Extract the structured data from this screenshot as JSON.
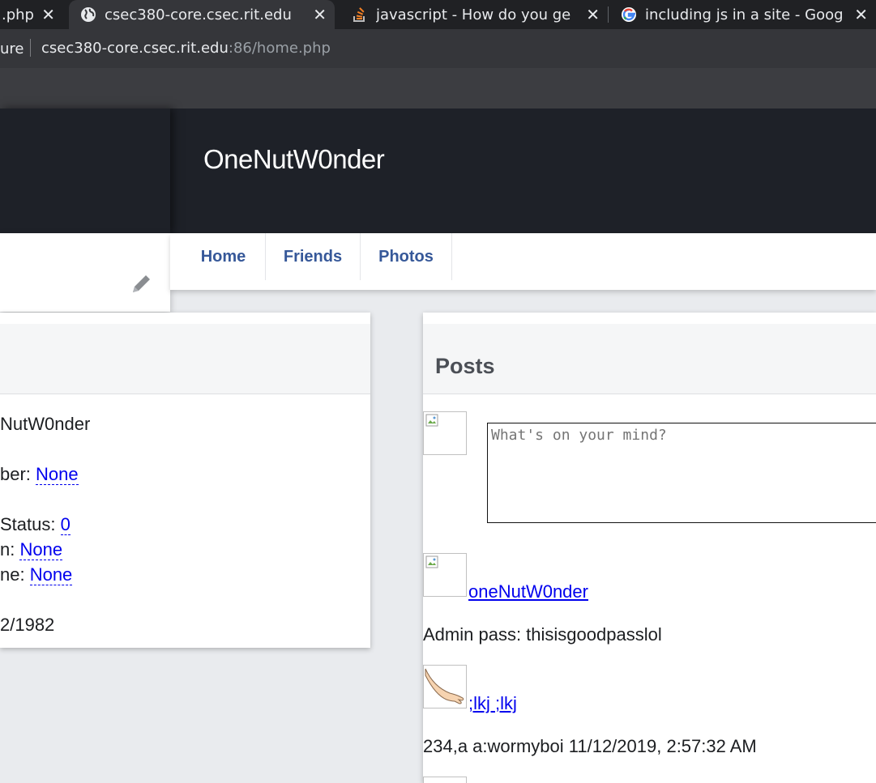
{
  "browser": {
    "tabs": [
      {
        "title": ".php",
        "icon": "none"
      },
      {
        "title": "csec380-core.csec.rit.edu",
        "icon": "globe-icon",
        "active": true
      },
      {
        "title": "javascript - How do you ge",
        "icon": "stackoverflow-icon"
      },
      {
        "title": "including js in a site - Goog",
        "icon": "google-icon"
      }
    ],
    "close_glyph": "✕",
    "security_label": "ure",
    "url_host": "csec380-core.csec.rit.edu",
    "url_rest": ":86/home.php"
  },
  "profile": {
    "name": "OneNutW0nder"
  },
  "nav": {
    "items": [
      "Home",
      "Friends",
      "Photos"
    ]
  },
  "about": {
    "name_fragment": "NutW0nder",
    "number_label": "ber: ",
    "number_value": "None",
    "status_label": "Status: ",
    "status_value": "0",
    "row2_label": "n: ",
    "row2_value": "None",
    "row3_label": "ne: ",
    "row3_value": "None",
    "date_fragment": "2/1982"
  },
  "posts": {
    "title": "Posts",
    "composer_placeholder": "What's on your mind?",
    "items": [
      {
        "author": "oneNutW0nder",
        "text": "Admin pass: thisisgoodpasslol"
      },
      {
        "author": ";lkj ;lkj",
        "text": "234,a a:wormyboi 11/12/2019, 2:57:32 AM"
      }
    ]
  },
  "colors": {
    "banner": "#1e2128",
    "nav_link": "#365899",
    "link": "#0000ee",
    "page_bg": "#e9ebee"
  }
}
